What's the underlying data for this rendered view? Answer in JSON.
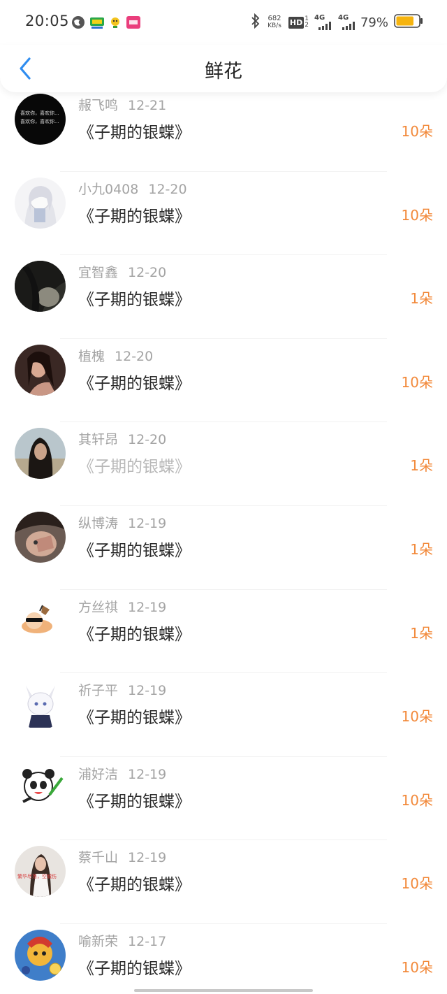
{
  "status_bar": {
    "time": "20:05",
    "net_speed_value": "682",
    "net_speed_unit": "KB/s",
    "hd_label": "HD",
    "net1": "4G",
    "net2": "4G",
    "battery": "79%",
    "icons": [
      "browser-icon",
      "app-tv-icon",
      "app-sun-icon",
      "app-pink-icon",
      "bluetooth-icon",
      "signal-icon",
      "battery-icon"
    ],
    "battery_level": 0.79,
    "battery_color": "#f6b40f"
  },
  "header": {
    "title": "鲜花",
    "back_icon": "chevron-left-icon",
    "accent": "#2f8df0"
  },
  "list": [
    {
      "name": "赧飞鸣",
      "date": "12-21",
      "book": "《子期的银蝶》",
      "flowers": "10朵"
    },
    {
      "name": "小九0408",
      "date": "12-20",
      "book": "《子期的银蝶》",
      "flowers": "10朵"
    },
    {
      "name": "宜智鑫",
      "date": "12-20",
      "book": "《子期的银蝶》",
      "flowers": "1朵"
    },
    {
      "name": "植槐",
      "date": "12-20",
      "book": "《子期的银蝶》",
      "flowers": "10朵"
    },
    {
      "name": "其轩昂",
      "date": "12-20",
      "book": "《子期的银蝶》",
      "flowers": "1朵"
    },
    {
      "name": "纵博涛",
      "date": "12-19",
      "book": "《子期的银蝶》",
      "flowers": "1朵"
    },
    {
      "name": "方丝祺",
      "date": "12-19",
      "book": "《子期的银蝶》",
      "flowers": "1朵"
    },
    {
      "name": "祈子平",
      "date": "12-19",
      "book": "《子期的银蝶》",
      "flowers": "10朵"
    },
    {
      "name": "浦好洁",
      "date": "12-19",
      "book": "《子期的银蝶》",
      "flowers": "10朵"
    },
    {
      "name": "蔡千山",
      "date": "12-19",
      "book": "《子期的银蝶》",
      "flowers": "10朵"
    },
    {
      "name": "喻新荣",
      "date": "12-17",
      "book": "《子期的银蝶》",
      "flowers": "10朵"
    }
  ],
  "avatar_text": {
    "row1": "喜欢你，喜欢你...",
    "row10": "繁华尽落，空城伤"
  },
  "colors": {
    "flower_count": "#f2893a",
    "meta": "#a4a4a4"
  }
}
